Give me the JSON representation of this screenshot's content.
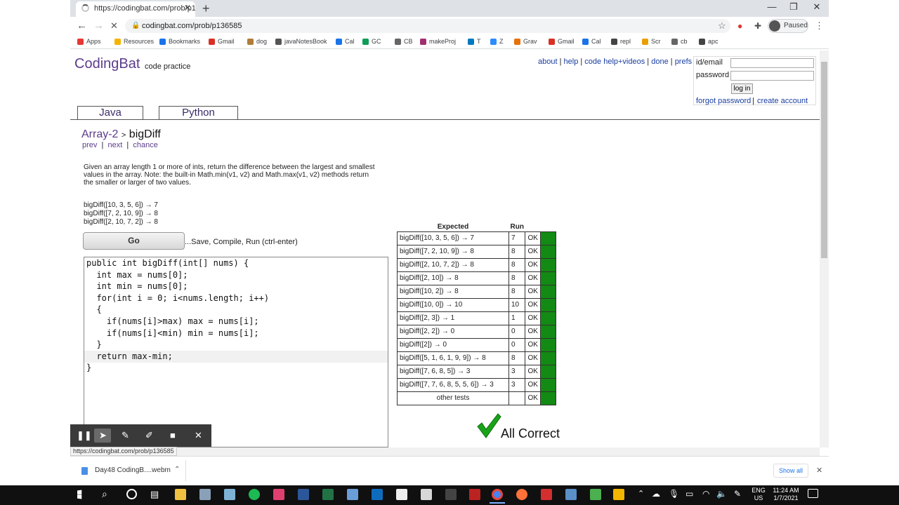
{
  "browser": {
    "tab_title": "https://codingbat.com/prob/p1...",
    "url": "codingbat.com/prob/p136585",
    "profile_status": "Paused",
    "status_url": "https://codingbat.com/prob/p136585",
    "bookmarks": [
      {
        "label": "Apps",
        "icon": "apps-grid-icon",
        "color": "#e53935"
      },
      {
        "label": "Resources",
        "icon": "folder-icon",
        "color": "#f5b400"
      },
      {
        "label": "Bookmarks",
        "icon": "star-icon",
        "color": "#1a73e8"
      },
      {
        "label": "Gmail",
        "icon": "gmail-icon",
        "color": "#d93025"
      },
      {
        "label": "dog",
        "icon": "dog-icon",
        "color": "#b07c3a"
      },
      {
        "label": "javaNotesBook",
        "icon": "notebook-icon",
        "color": "#555555"
      },
      {
        "label": "Cal",
        "icon": "calendar-icon",
        "color": "#1a73e8"
      },
      {
        "label": "GC",
        "icon": "classroom-icon",
        "color": "#0f9d58"
      },
      {
        "label": "CB",
        "icon": "globe-icon",
        "color": "#666666"
      },
      {
        "label": "makeProj",
        "icon": "m-icon",
        "color": "#a03070"
      },
      {
        "label": "T",
        "icon": "trello-icon",
        "color": "#0079bf"
      },
      {
        "label": "Z",
        "icon": "zoom-icon",
        "color": "#2d8cff"
      },
      {
        "label": "Grav",
        "icon": "gravity-icon",
        "color": "#e8710a"
      },
      {
        "label": "Gmail",
        "icon": "gmail-icon",
        "color": "#d93025"
      },
      {
        "label": "Cal",
        "icon": "calendar-icon",
        "color": "#1a73e8"
      },
      {
        "label": "repl",
        "icon": "replit-icon",
        "color": "#444444"
      },
      {
        "label": "Scr",
        "icon": "scratch-icon",
        "color": "#e8a000"
      },
      {
        "label": "cb",
        "icon": "globe-icon",
        "color": "#666666"
      },
      {
        "label": "apc",
        "icon": "apc-icon",
        "color": "#444444"
      }
    ]
  },
  "site": {
    "logo": "CodingBat",
    "logo_sub": "code practice",
    "top_links": [
      "about",
      "help",
      "code help+videos",
      "done",
      "prefs"
    ],
    "login": {
      "id_label": "id/email",
      "password_label": "password",
      "login_button": "log in",
      "forgot": "forgot password",
      "create": "create account"
    },
    "tabs": [
      "Java",
      "Python"
    ],
    "accent": "#5c3c8c"
  },
  "problem": {
    "section": "Array-2",
    "name": "bigDiff",
    "nav": [
      "prev",
      "next",
      "chance"
    ],
    "description": "Given an array length 1 or more of ints, return the difference between the largest and smallest values in the array. Note: the built-in Math.min(v1, v2) and Math.max(v1, v2) methods return the smaller or larger of two values.",
    "examples": [
      "bigDiff([10, 3, 5, 6]) → 7",
      "bigDiff([7, 2, 10, 9]) → 8",
      "bigDiff([2, 10, 7, 2]) → 8"
    ],
    "go_label": "Go",
    "go_hint": "...Save, Compile, Run (ctrl-enter)"
  },
  "code_lines": [
    "public int bigDiff(int[] nums) {",
    "  int max = nums[0];",
    "  int min = nums[0];",
    "  for(int i = 0; i<nums.length; i++)",
    "  {",
    "    if(nums[i]>max) max = nums[i];",
    "    if(nums[i]<min) min = nums[i];",
    "  }",
    "  return max-min;",
    "}"
  ],
  "results": {
    "headers": [
      "Expected",
      "Run"
    ],
    "rows": [
      {
        "expected": "bigDiff([10, 3, 5, 6]) → 7",
        "run": "7",
        "status": "OK"
      },
      {
        "expected": "bigDiff([7, 2, 10, 9]) → 8",
        "run": "8",
        "status": "OK"
      },
      {
        "expected": "bigDiff([2, 10, 7, 2]) → 8",
        "run": "8",
        "status": "OK"
      },
      {
        "expected": "bigDiff([2, 10]) → 8",
        "run": "8",
        "status": "OK"
      },
      {
        "expected": "bigDiff([10, 2]) → 8",
        "run": "8",
        "status": "OK"
      },
      {
        "expected": "bigDiff([10, 0]) → 10",
        "run": "10",
        "status": "OK"
      },
      {
        "expected": "bigDiff([2, 3]) → 1",
        "run": "1",
        "status": "OK"
      },
      {
        "expected": "bigDiff([2, 2]) → 0",
        "run": "0",
        "status": "OK"
      },
      {
        "expected": "bigDiff([2]) → 0",
        "run": "0",
        "status": "OK"
      },
      {
        "expected": "bigDiff([5, 1, 6, 1, 9, 9]) → 8",
        "run": "8",
        "status": "OK"
      },
      {
        "expected": "bigDiff([7, 6, 8, 5]) → 3",
        "run": "3",
        "status": "OK"
      },
      {
        "expected": "bigDiff([7, 7, 6, 8, 5, 5, 6]) → 3",
        "run": "3",
        "status": "OK"
      },
      {
        "expected": "other tests",
        "run": "",
        "status": "OK"
      }
    ],
    "pass_color": "#138a13",
    "summary": "All Correct"
  },
  "download_bar": {
    "file": "Day48 CodingB....webm",
    "show_all": "Show all"
  },
  "taskbar": {
    "lang": "ENG",
    "region": "US",
    "time": "11:24 AM",
    "date": "1/7/2021"
  }
}
